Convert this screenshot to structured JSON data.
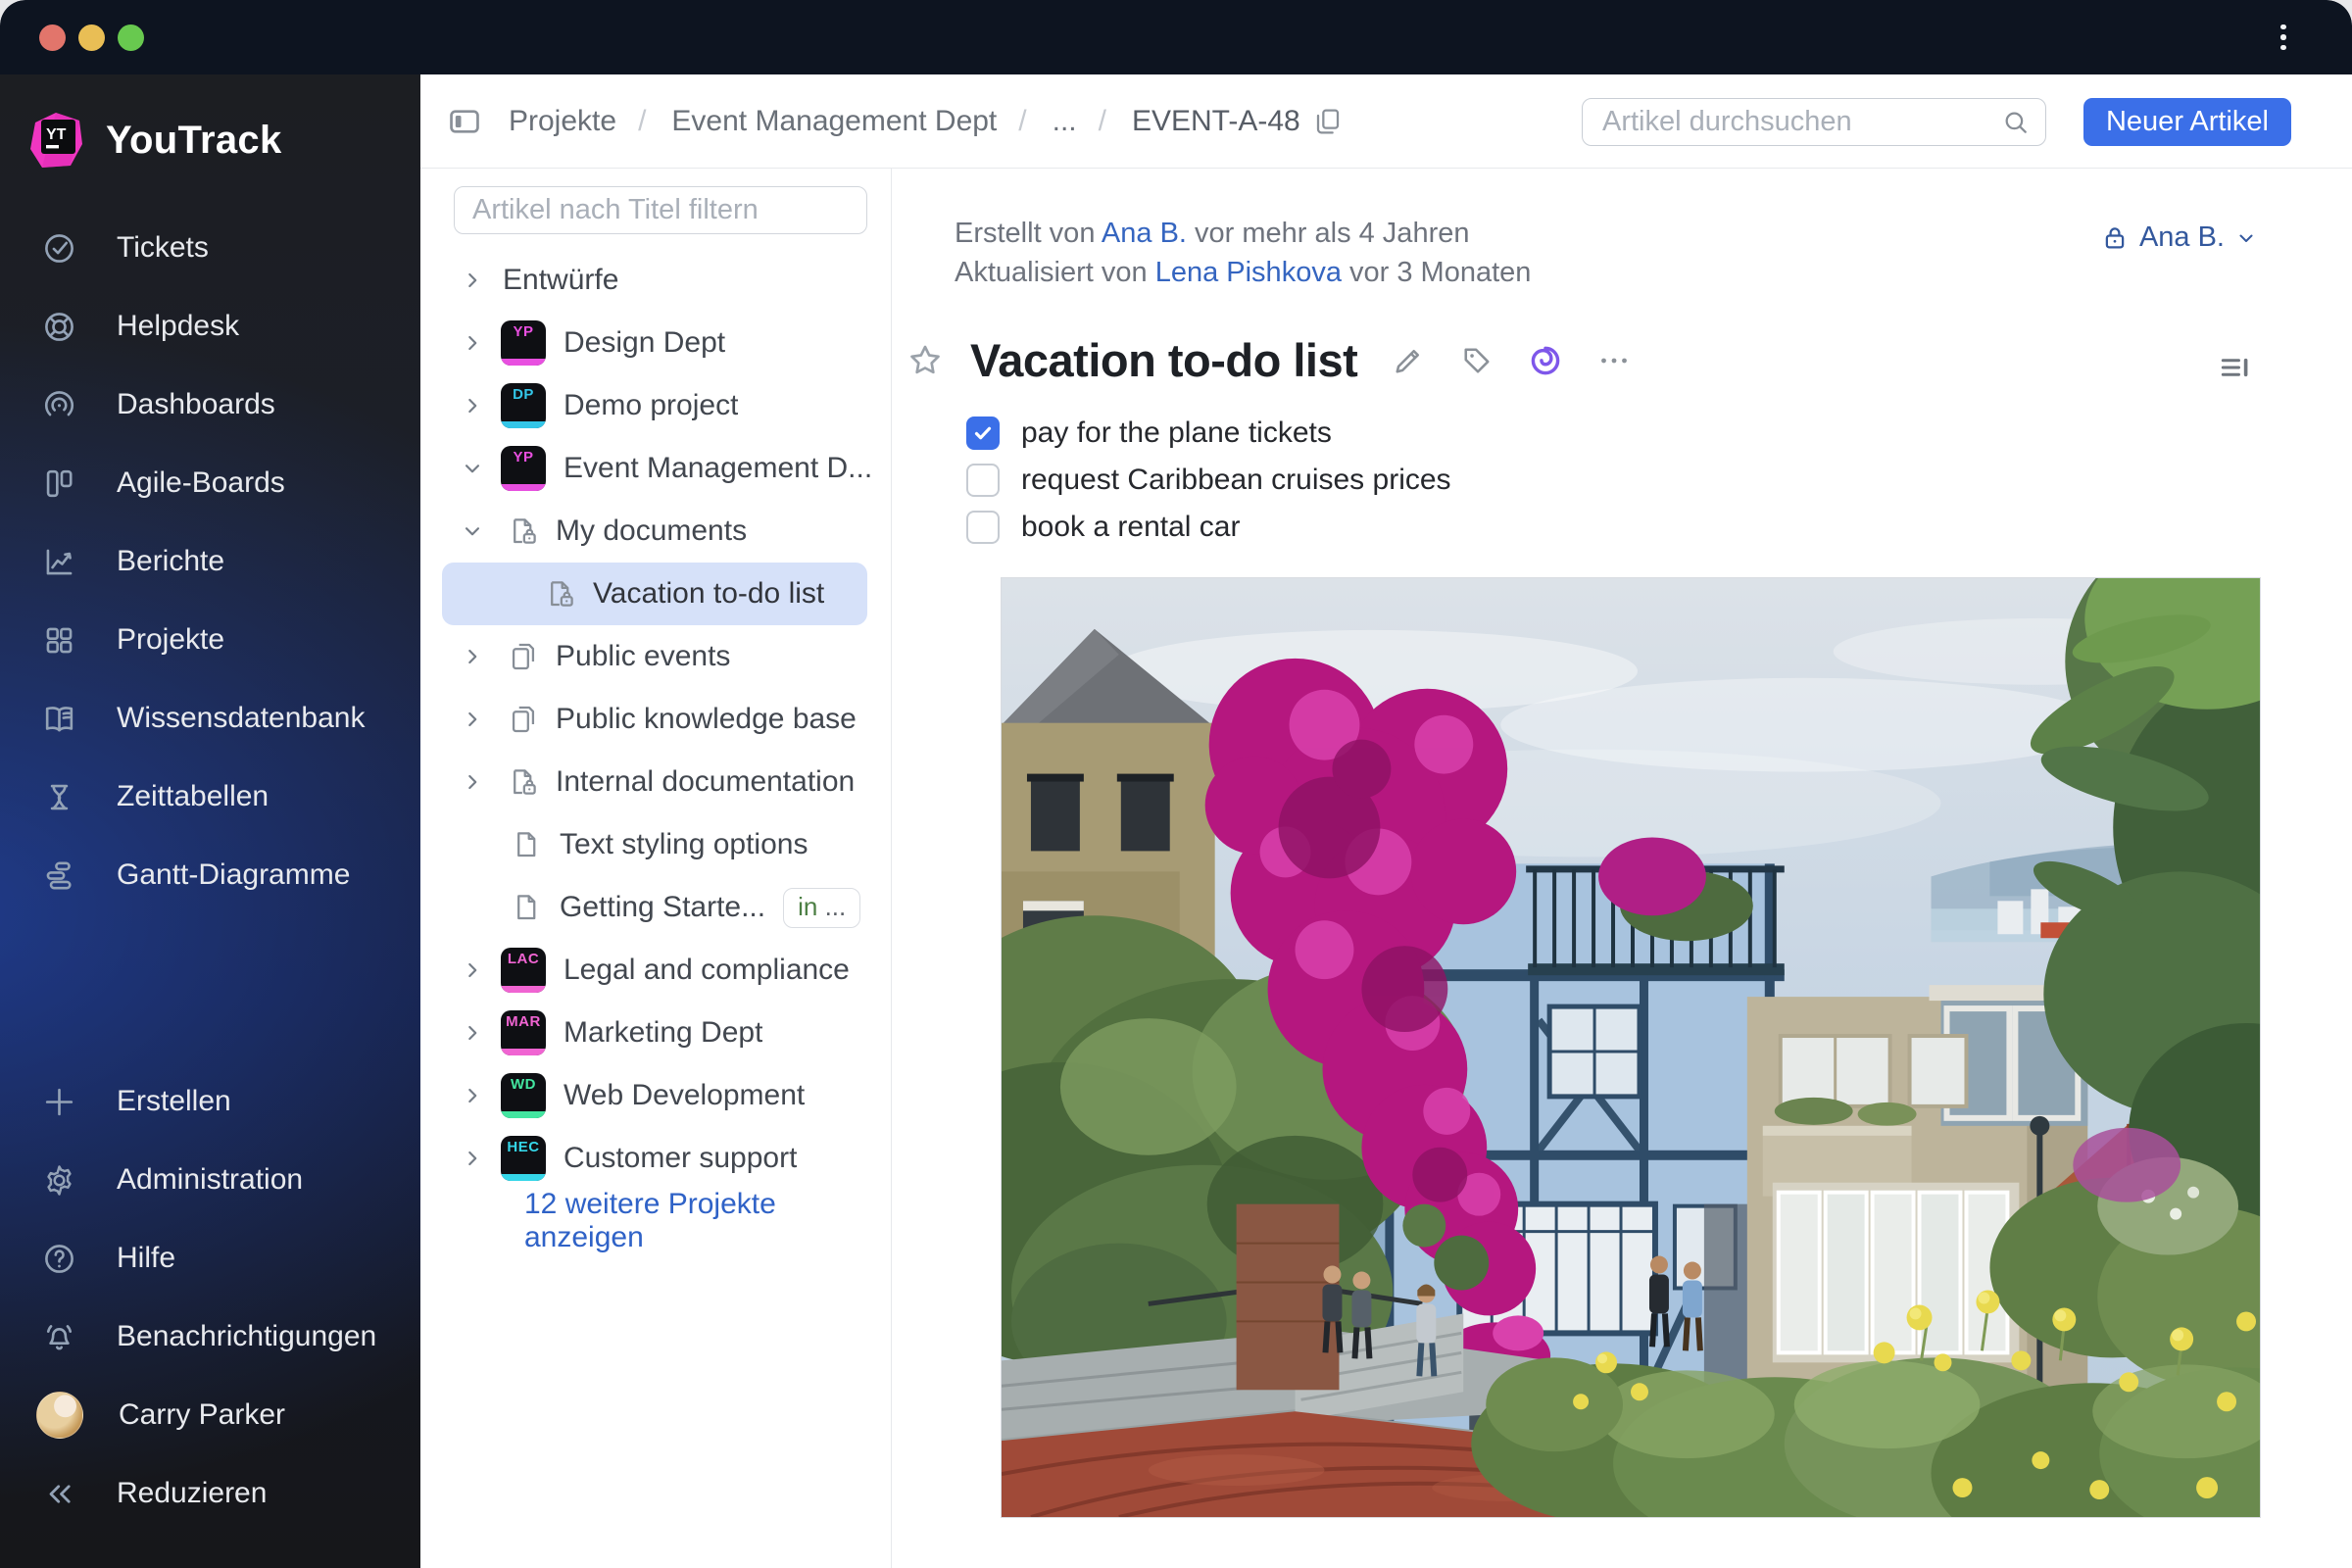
{
  "colors": {
    "accent": "#3B6FE8",
    "link": "#3565C0",
    "selected": "#D6E1F9",
    "titlebar": "#0D1420",
    "traffic-red": "#E2756B",
    "traffic-yellow": "#E9BE55",
    "traffic-green": "#68C94F"
  },
  "sidebar": {
    "logo_text": "YouTrack",
    "items": [
      {
        "icon": "check-circle-icon",
        "label": "Tickets"
      },
      {
        "icon": "lifebuoy-icon",
        "label": "Helpdesk"
      },
      {
        "icon": "gauge-icon",
        "label": "Dashboards"
      },
      {
        "icon": "board-columns-icon",
        "label": "Agile-Boards"
      },
      {
        "icon": "line-chart-icon",
        "label": "Berichte"
      },
      {
        "icon": "grid-icon",
        "label": "Projekte"
      },
      {
        "icon": "open-book-icon",
        "label": "Wissensdatenbank"
      },
      {
        "icon": "hourglass-icon",
        "label": "Zeittabellen"
      },
      {
        "icon": "gantt-bars-icon",
        "label": "Gantt-Diagramme"
      }
    ],
    "footer_items": [
      {
        "icon": "plus-icon",
        "label": "Erstellen"
      },
      {
        "icon": "gear-icon",
        "label": "Administration"
      },
      {
        "icon": "question-circle-icon",
        "label": "Hilfe"
      },
      {
        "icon": "bell-icon",
        "label": "Benachrichtigungen"
      }
    ],
    "user": {
      "name": "Carry Parker"
    },
    "collapse_label": "Reduzieren"
  },
  "topbar": {
    "breadcrumb": {
      "item0": "Projekte",
      "item1": "Event Management Dept",
      "item2": "...",
      "item3": "EVENT-A-48"
    },
    "search_placeholder": "Artikel durchsuchen",
    "new_article_label": "Neuer Artikel"
  },
  "tree": {
    "filter_placeholder": "Artikel nach Titel filtern",
    "items": [
      {
        "label": "Entwürfe",
        "type": "drafts-group",
        "expanded": false
      },
      {
        "label": "Design Dept",
        "type": "project",
        "initials": "YP",
        "color": "#E84FE0",
        "expanded": false
      },
      {
        "label": "Demo project",
        "type": "project",
        "initials": "DP",
        "color": "#33C6E8",
        "expanded": false
      },
      {
        "label": "Event Management D...",
        "type": "project",
        "initials": "YP",
        "color": "#E84FE0",
        "expanded": true
      },
      {
        "label": "My documents",
        "type": "article-locked",
        "expanded": true
      },
      {
        "label": "Vacation to-do list",
        "type": "article-locked",
        "selected": true
      },
      {
        "label": "Public events",
        "type": "article-stack",
        "expanded": false
      },
      {
        "label": "Public knowledge base",
        "type": "article-stack",
        "expanded": false
      },
      {
        "label": "Internal documentation",
        "type": "article-locked",
        "expanded": false
      },
      {
        "label": "Text styling options",
        "type": "article"
      },
      {
        "label": "Getting Starte...",
        "type": "article",
        "badge_in": "in",
        "badge_dots": " ..."
      },
      {
        "label": "Legal and compliance",
        "type": "project",
        "initials": "LAC",
        "color": "#F064D2",
        "expanded": false
      },
      {
        "label": "Marketing Dept",
        "type": "project",
        "initials": "MAR",
        "color": "#F064D2",
        "expanded": false
      },
      {
        "label": "Web Development",
        "type": "project",
        "initials": "WD",
        "color": "#43E5A0",
        "expanded": false
      },
      {
        "label": "Customer support",
        "type": "project",
        "initials": "HEC",
        "color": "#35D6E8",
        "expanded": false
      }
    ],
    "more_link": "12 weitere Projekte anzeigen"
  },
  "article": {
    "created_prefix": "Erstellt von ",
    "created_author": "Ana B.",
    "created_suffix": " vor mehr als 4 Jahren",
    "updated_prefix": "Aktualisiert von ",
    "updated_author": "Lena Pishkova",
    "updated_suffix": " vor 3 Monaten",
    "visibility": "Ana B.",
    "title": "Vacation to-do list",
    "checklist": [
      {
        "label": "pay for the plane tickets",
        "checked": true
      },
      {
        "label": "request Caribbean cruises prices",
        "checked": false
      },
      {
        "label": "book a rental car",
        "checked": false
      }
    ]
  }
}
